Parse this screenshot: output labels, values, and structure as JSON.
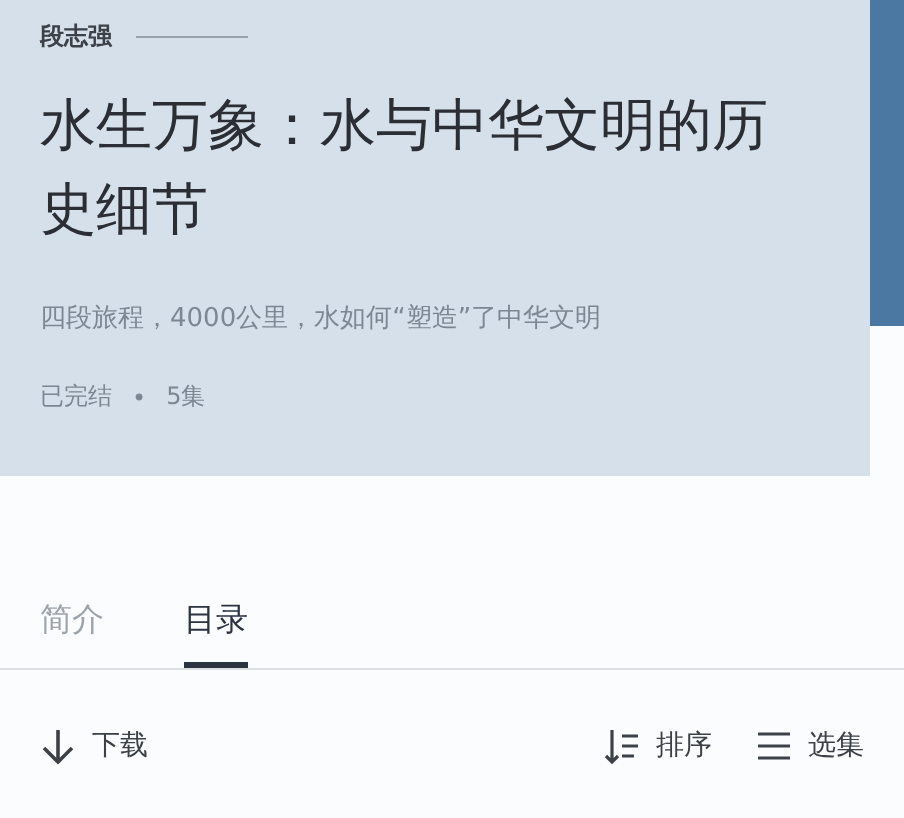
{
  "header": {
    "author": "段志强",
    "title": "水生万象：水与中华文明的历史细节",
    "subtitle": "四段旅程，4000公里，水如何“塑造”了中华文明",
    "status": "已完结",
    "separator": "•",
    "episodes": "5集"
  },
  "tabs": [
    {
      "label": "简介",
      "selected": false
    },
    {
      "label": "目录",
      "selected": true
    }
  ],
  "toolbar": [
    {
      "kind": "download",
      "label": "下载"
    },
    {
      "kind": "sort",
      "label": "排序"
    },
    {
      "kind": "select",
      "label": "选集"
    }
  ]
}
